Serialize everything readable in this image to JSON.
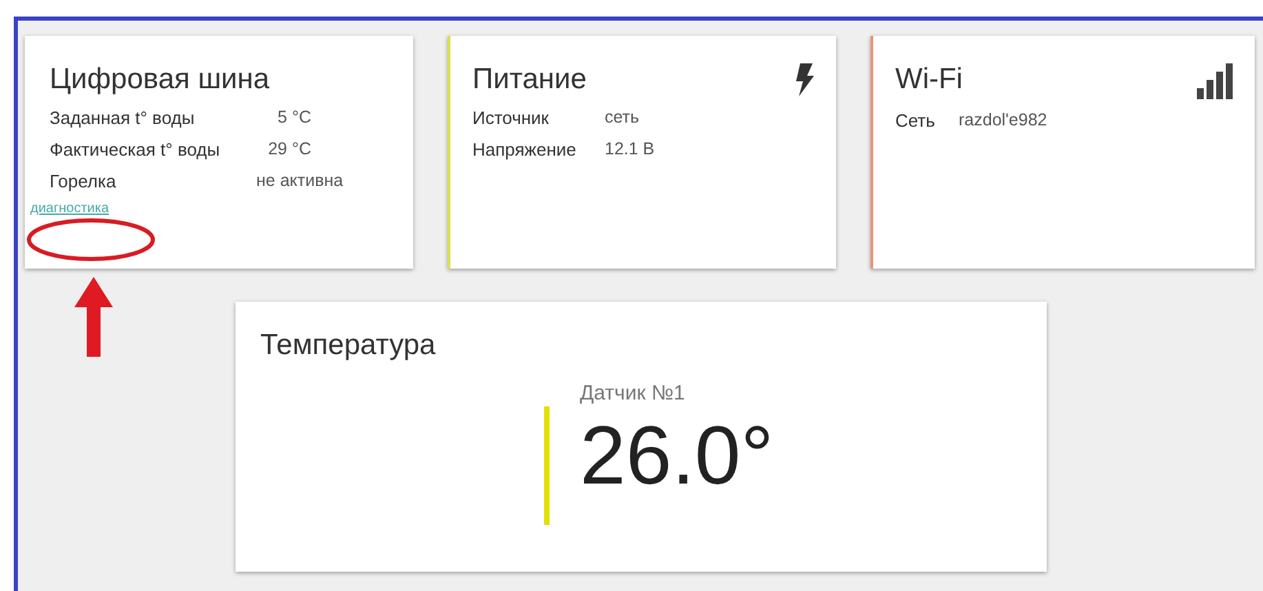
{
  "cards": [
    {
      "kind": "bus",
      "title": "Цифровая шина",
      "color": "#ffffff",
      "rows": [
        {
          "label": "Заданная t° воды",
          "value": "5 °C"
        },
        {
          "label": "Фактическая t° воды",
          "value": "29 °C"
        },
        {
          "label": "Горелка",
          "value": "не активна"
        }
      ],
      "link": "диагностика"
    },
    {
      "kind": "power",
      "title": "Питание",
      "color": "#d8e24a",
      "rows": [
        {
          "label": "Источник",
          "value": "сеть"
        },
        {
          "label": "Напряжение",
          "value": "12.1 В"
        }
      ]
    },
    {
      "kind": "wifi",
      "title": "Wi-Fi",
      "color": "#e8957c",
      "rows": [
        {
          "label": "Сеть",
          "value": "razdol'e982"
        }
      ]
    }
  ],
  "temperature": {
    "title": "Температура",
    "sensors": [
      {
        "name": "Датчик №1",
        "value": "26.0°",
        "color": "#e2e000"
      }
    ]
  }
}
